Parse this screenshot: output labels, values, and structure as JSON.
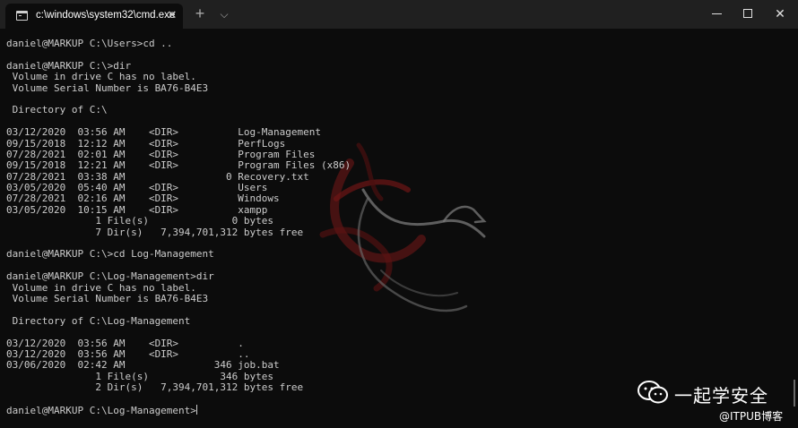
{
  "window": {
    "tab_title": "c:\\windows\\system32\\cmd.exe",
    "tab_close_glyph": "✕",
    "new_tab_glyph": "+",
    "dropdown_glyph": "⌵",
    "close_glyph": "✕"
  },
  "terminal": {
    "lines": [
      "daniel@MARKUP C:\\Users>cd ..",
      "",
      "daniel@MARKUP C:\\>dir",
      " Volume in drive C has no label.",
      " Volume Serial Number is BA76-B4E3",
      "",
      " Directory of C:\\",
      "",
      "03/12/2020  03:56 AM    <DIR>          Log-Management",
      "09/15/2018  12:12 AM    <DIR>          PerfLogs",
      "07/28/2021  02:01 AM    <DIR>          Program Files",
      "09/15/2018  12:21 AM    <DIR>          Program Files (x86)",
      "07/28/2021  03:38 AM                 0 Recovery.txt",
      "03/05/2020  05:40 AM    <DIR>          Users",
      "07/28/2021  02:16 AM    <DIR>          Windows",
      "03/05/2020  10:15 AM    <DIR>          xampp",
      "               1 File(s)              0 bytes",
      "               7 Dir(s)   7,394,701,312 bytes free",
      "",
      "daniel@MARKUP C:\\>cd Log-Management",
      "",
      "daniel@MARKUP C:\\Log-Management>dir",
      " Volume in drive C has no label.",
      " Volume Serial Number is BA76-B4E3",
      "",
      " Directory of C:\\Log-Management",
      "",
      "03/12/2020  03:56 AM    <DIR>          .",
      "03/12/2020  03:56 AM    <DIR>          ..",
      "03/06/2020  02:42 AM               346 job.bat",
      "               1 File(s)            346 bytes",
      "               2 Dir(s)   7,394,701,312 bytes free",
      ""
    ],
    "prompt": "daniel@MARKUP C:\\Log-Management>"
  },
  "watermark": {
    "name": "一起学安全",
    "sub": "@ITPUB博客",
    "logo_icon": "wechat-icon"
  },
  "colors": {
    "background": "#0c0c0c",
    "titlebar": "#202020",
    "text": "#cccccc",
    "dragon_accent": "#8b1a1a"
  }
}
